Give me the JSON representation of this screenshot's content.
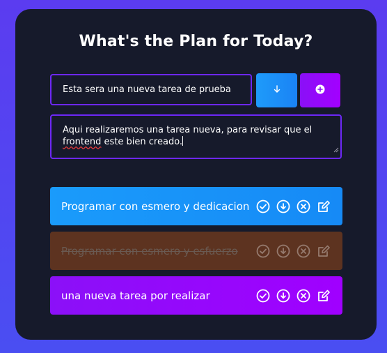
{
  "app": {
    "title": "What's the Plan for Today?"
  },
  "form": {
    "task_input_value": "Esta sera una nueva tarea de prueba",
    "description_text_part1": "Aqui realizaremos una tarea nueva, para revisar que el",
    "description_misspelled": "frontend",
    "description_text_part2": " este bien creado.",
    "down_button_icon": "arrow-down-icon",
    "add_button_icon": "plus-circle-icon"
  },
  "tasks": [
    {
      "label": "Programar con esmero y dedicacion",
      "completed": false,
      "color": "#1a8ffb"
    },
    {
      "label": "Programar con esmero y esfuerzo",
      "completed": true,
      "color": "#5d3320"
    },
    {
      "label": "una nueva tarea por realizar",
      "completed": false,
      "color": "#9b00ff"
    }
  ],
  "task_actions": [
    "check-circle-icon",
    "download-circle-icon",
    "close-circle-icon",
    "edit-icon"
  ],
  "colors": {
    "background": "#5048f0",
    "card": "#161a2b",
    "accent_border": "#6d28f6",
    "blue": "#1a8ffb",
    "purple": "#9b00ff",
    "completed": "#5d3320"
  }
}
